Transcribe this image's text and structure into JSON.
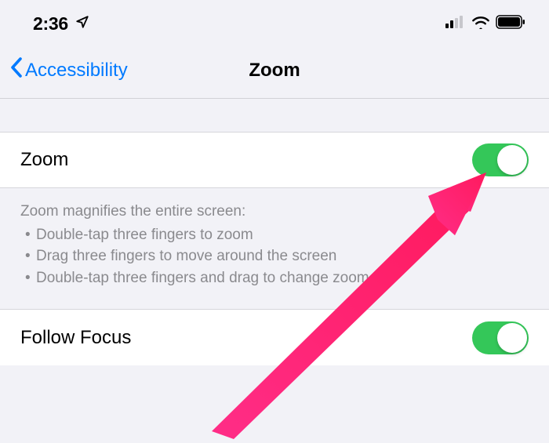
{
  "status": {
    "time": "2:36"
  },
  "nav": {
    "back_label": "Accessibility",
    "title": "Zoom"
  },
  "cells": {
    "zoom": {
      "label": "Zoom",
      "toggle_on": true
    },
    "follow_focus": {
      "label": "Follow Focus",
      "toggle_on": true
    }
  },
  "description": {
    "heading": "Zoom magnifies the entire screen:",
    "bullets": [
      "Double-tap three fingers to zoom",
      "Drag three fingers to move around the screen",
      "Double-tap three fingers and drag to change zoom"
    ]
  }
}
